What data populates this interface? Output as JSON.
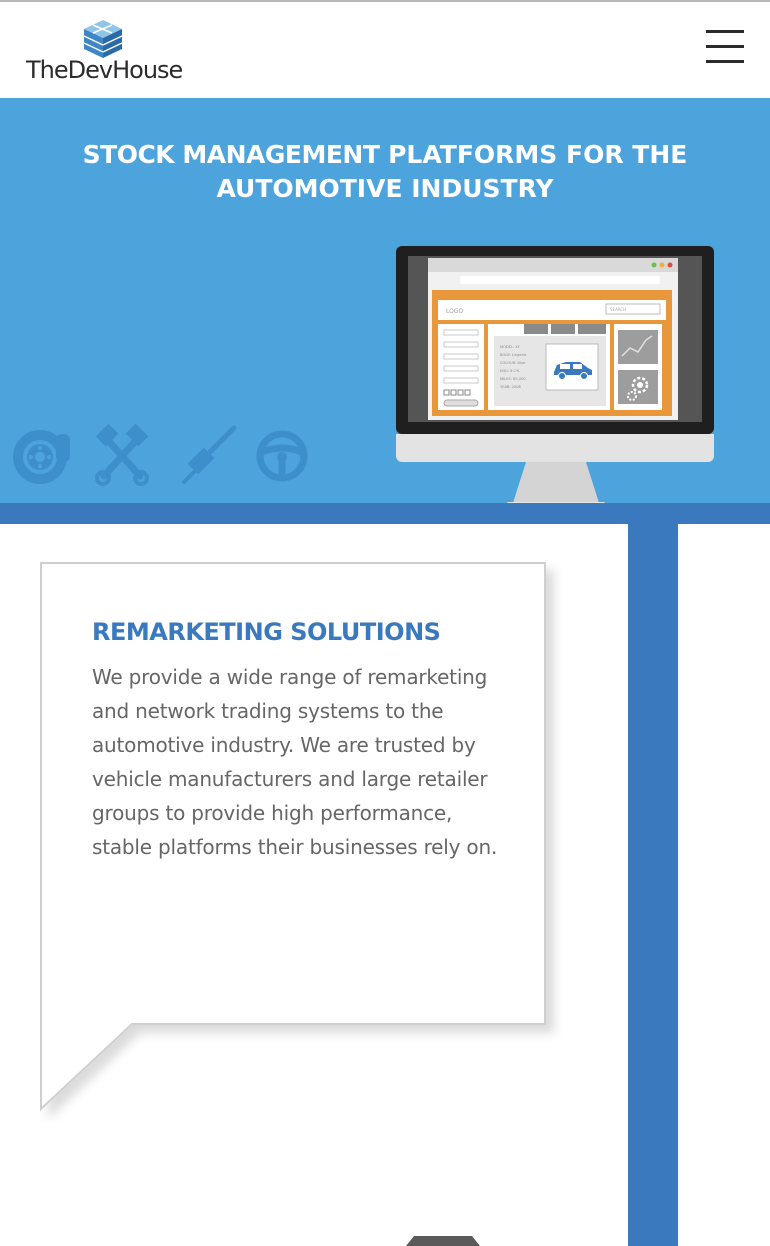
{
  "header": {
    "logo_text": "TheDevHouse",
    "logo_icon": "cube-logo-icon",
    "menu_icon": "hamburger-menu-icon"
  },
  "hero": {
    "title_bold": "STOCK MANAGEMENT",
    "title_rest": " PLATFORMS FOR THE AUTOMOTIVE INDUSTRY",
    "icons": [
      "brake-disc-icon",
      "crossed-pistons-icon",
      "spark-plug-icon",
      "steering-wheel-icon"
    ],
    "screen": {
      "logo_label": "LOGO",
      "search_label": "SEARCH",
      "listing_lines": [
        "MODEL: XF",
        "BODY: Lingerie",
        "COLOUR: Blue",
        "ENG: 8 CYL",
        "MILES: 85,000",
        "YEAR: 2008"
      ]
    }
  },
  "card": {
    "title": "REMARKETING SOLUTIONS",
    "body": "We provide a wide range of remarketing and network trading systems to the automotive industry. We are trusted by vehicle manufacturers and large retailer groups to provide high performance, stable platforms their businesses rely on."
  },
  "colors": {
    "hero_bg": "#4da4dd",
    "accent_blue": "#3a79bd",
    "screen_orange": "#e8983a",
    "body_text": "#666666"
  }
}
